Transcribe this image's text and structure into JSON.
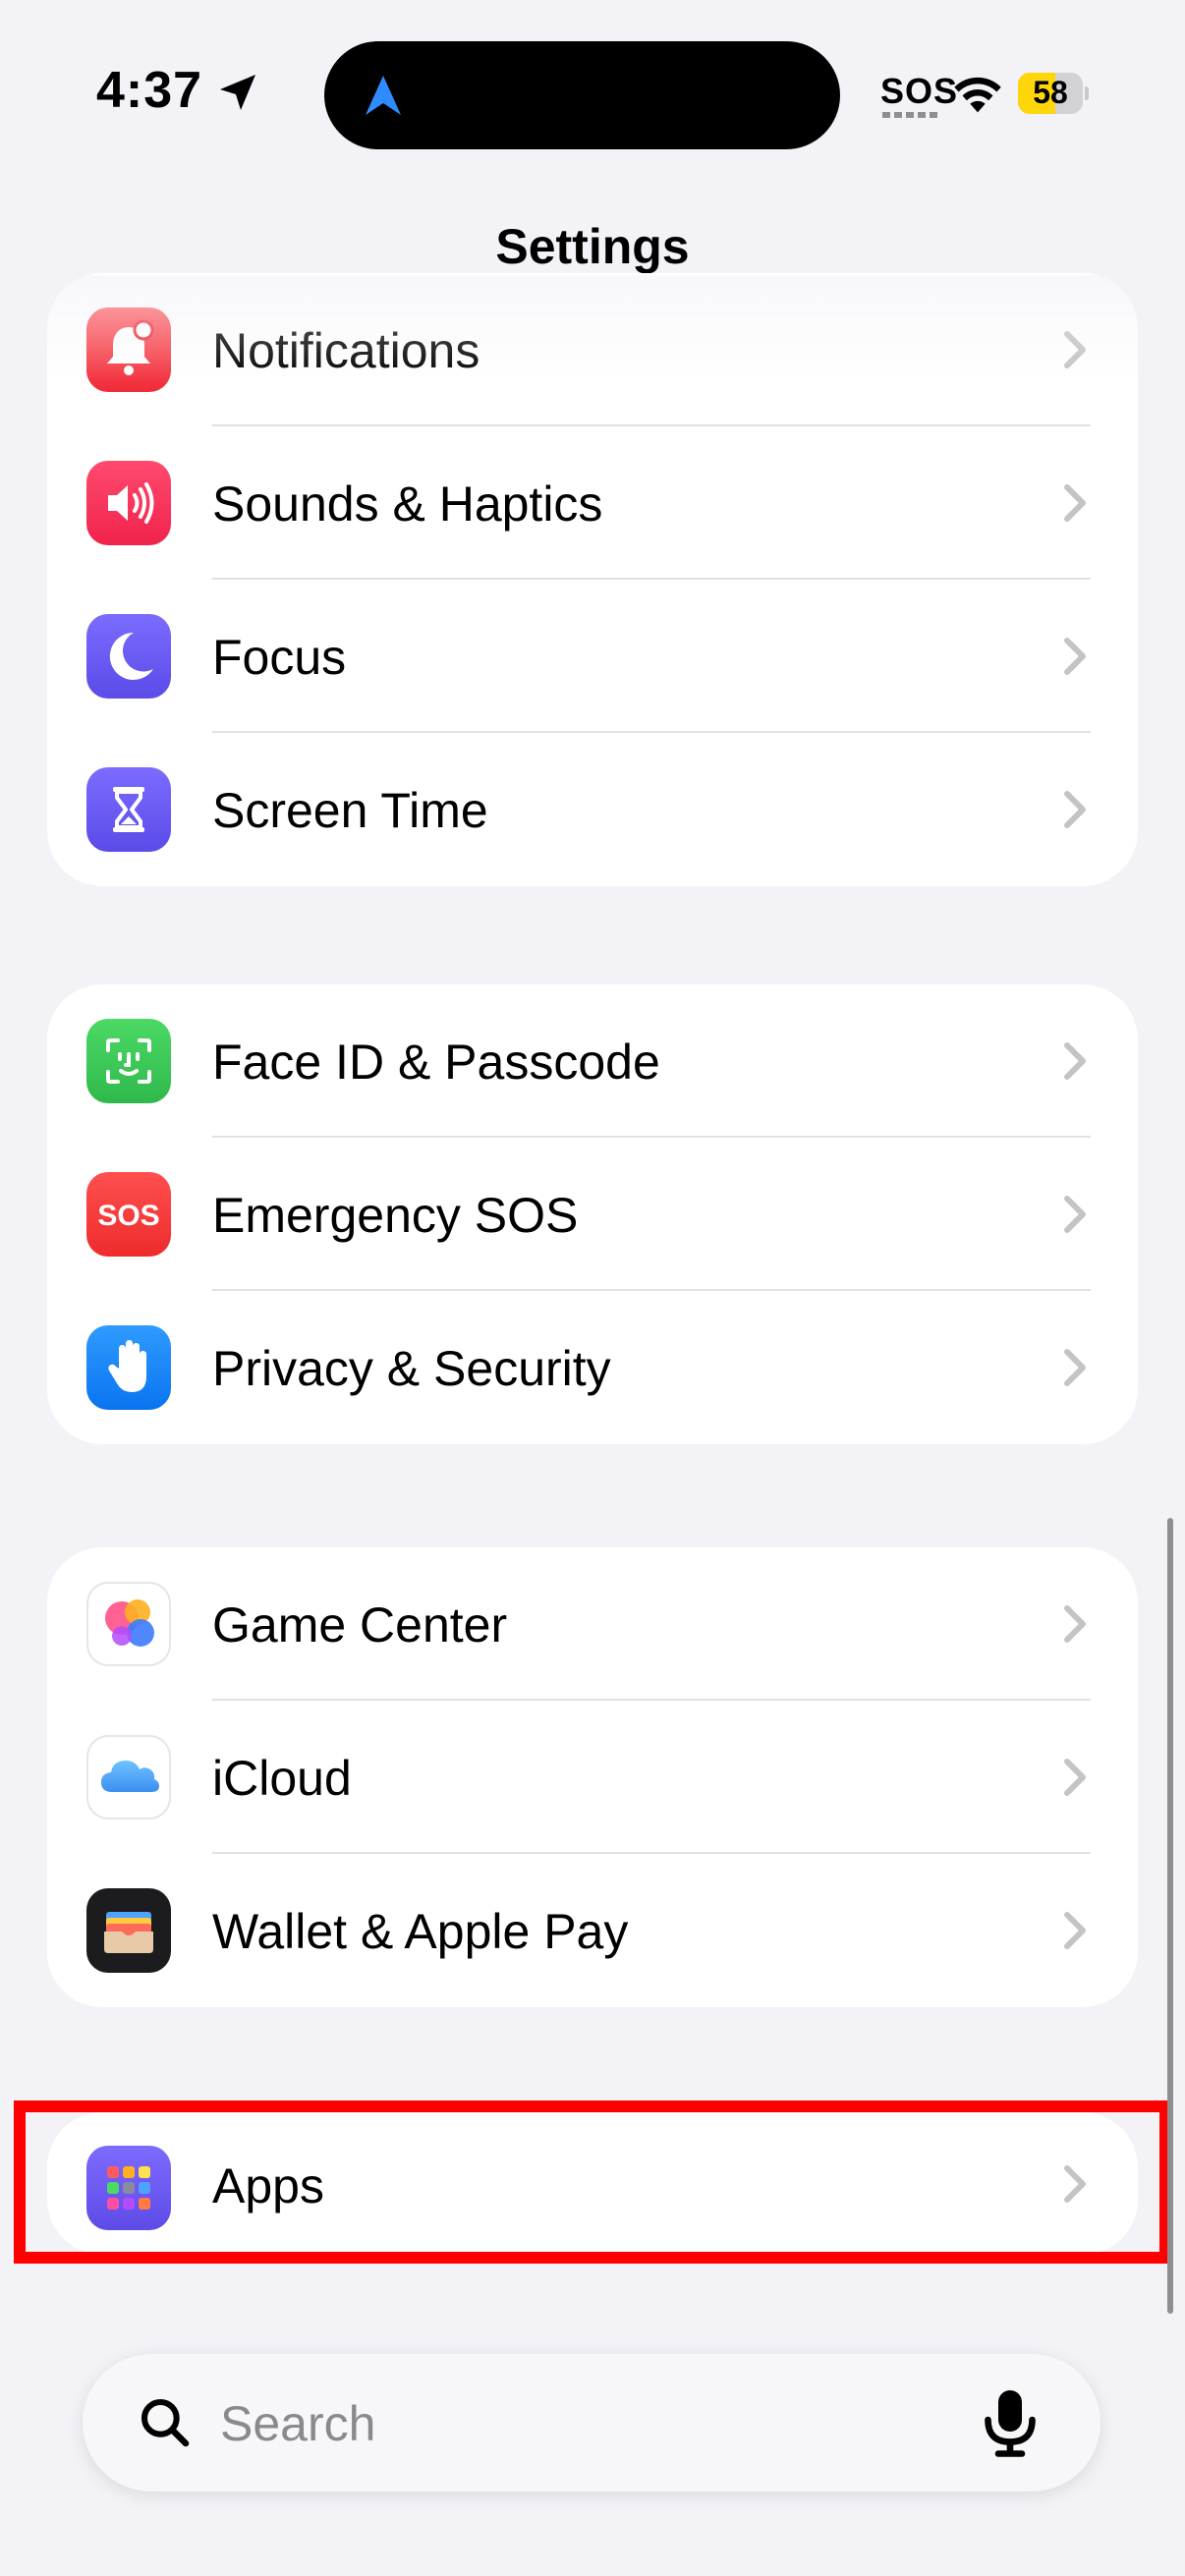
{
  "status_bar": {
    "time": "4:37",
    "carrier_status": "SOS",
    "battery_percent": "58",
    "battery_level": 0.58
  },
  "header": {
    "title": "Settings"
  },
  "groups": [
    {
      "items": [
        {
          "label": "Notifications",
          "icon": "bell-icon",
          "color": "#FF3B30"
        },
        {
          "label": "Sounds & Haptics",
          "icon": "speaker-icon",
          "color": "#FF2D55"
        },
        {
          "label": "Focus",
          "icon": "moon-icon",
          "color": "#5E5CE6"
        },
        {
          "label": "Screen Time",
          "icon": "hourglass-icon",
          "color": "#5E5CE6"
        }
      ]
    },
    {
      "items": [
        {
          "label": "Face ID & Passcode",
          "icon": "face-id-icon",
          "color": "#34C759"
        },
        {
          "label": "Emergency SOS",
          "icon": "sos-icon",
          "icon_text": "SOS",
          "color": "#FF3B30"
        },
        {
          "label": "Privacy & Security",
          "icon": "hand-icon",
          "color": "#0A84FF"
        }
      ]
    },
    {
      "items": [
        {
          "label": "Game Center",
          "icon": "game-center-icon"
        },
        {
          "label": "iCloud",
          "icon": "cloud-icon",
          "color": "#4FA8F8"
        },
        {
          "label": "Wallet & Apple Pay",
          "icon": "wallet-icon",
          "color": "#1C1C1E"
        }
      ]
    },
    {
      "items": [
        {
          "label": "Apps",
          "icon": "apps-grid-icon",
          "color": "#6E5CF6"
        }
      ]
    }
  ],
  "search": {
    "placeholder": "Search"
  },
  "highlight_color": "#FF0000"
}
